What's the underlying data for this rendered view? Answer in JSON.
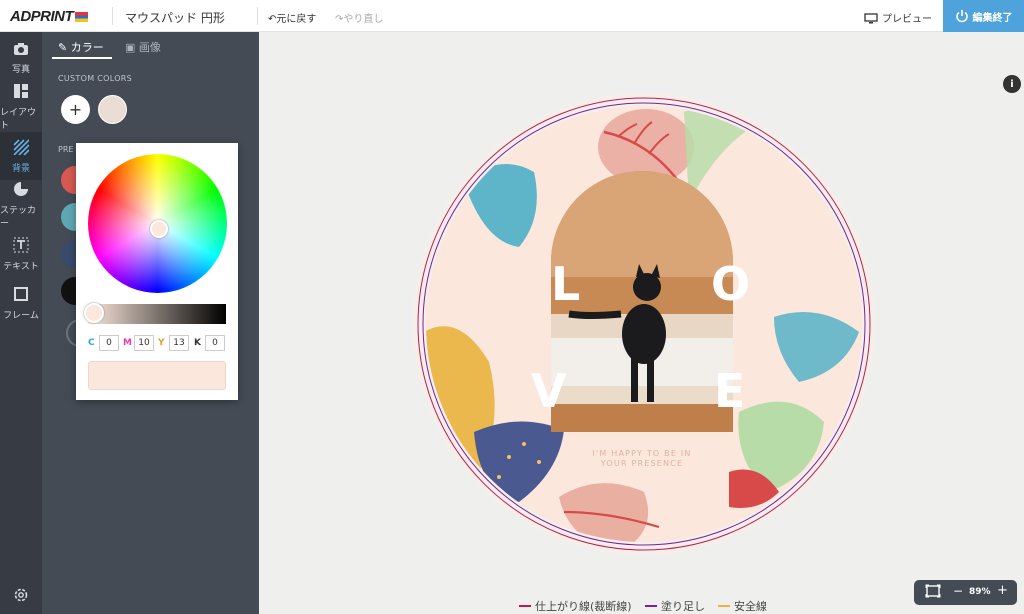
{
  "header": {
    "logo": "ADPRINT",
    "document_title": "マウスパッド 円形",
    "undo_label": "元に戻す",
    "redo_label": "やり直し",
    "preview_label": "プレビュー",
    "finish_label": "編集終了"
  },
  "rail": {
    "items": [
      {
        "label": "写真",
        "icon": "camera-icon"
      },
      {
        "label": "レイアウト",
        "icon": "layout-icon"
      },
      {
        "label": "背景",
        "icon": "background-icon"
      },
      {
        "label": "ステッカー",
        "icon": "sticker-icon"
      },
      {
        "label": "テキスト",
        "icon": "text-icon"
      },
      {
        "label": "フレーム",
        "icon": "frame-icon"
      }
    ],
    "active": "背景",
    "settings_icon": "gear-icon"
  },
  "panel": {
    "tabs": [
      {
        "label": "カラー",
        "icon": "eyedropper-icon"
      },
      {
        "label": "画像",
        "icon": "image-icon"
      }
    ],
    "custom_colors_label": "CUSTOM COLORS",
    "preset_label_visible": "PRE",
    "custom_swatches": [
      "#e9ddd4"
    ],
    "preset_swatches": [
      "#d65a52",
      "#5ea8b4",
      "#3a4a6b",
      "#111111"
    ]
  },
  "picker": {
    "cmyk": {
      "C": "0",
      "M": "10",
      "Y": "13",
      "K": "0"
    },
    "color": "#fbe7dc"
  },
  "design": {
    "letters": [
      "L",
      "O",
      "V",
      "E"
    ],
    "tagline_1": "I'M HAPPY TO BE IN",
    "tagline_2": "YOUR PRESENCE"
  },
  "legend": [
    {
      "label": "仕上がり線(裁断線)",
      "color": "#c2185b"
    },
    {
      "label": "塗り足し",
      "color": "#7b1fa2"
    },
    {
      "label": "安全線",
      "color": "#f0b040"
    }
  ],
  "zoom": {
    "value": "89%"
  },
  "info_label": "i"
}
